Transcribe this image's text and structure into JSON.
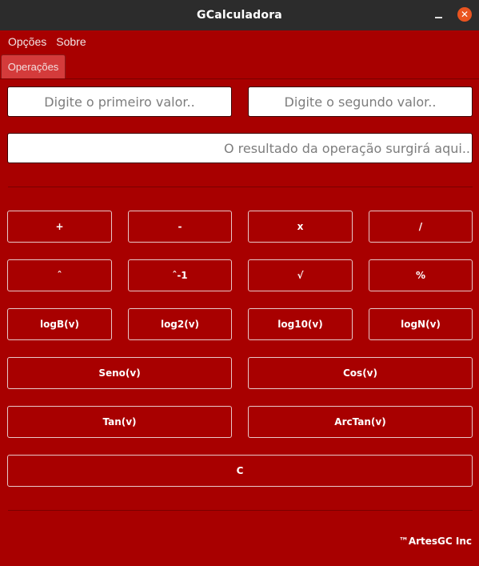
{
  "window": {
    "title": "GCalculadora",
    "minimize_icon": "minimize-icon",
    "close_icon": "close-icon",
    "close_glyph": "✕",
    "close_color": "#e95420"
  },
  "menu": {
    "items": [
      "Opções",
      "Sobre"
    ]
  },
  "tabs": [
    {
      "label": "Operações",
      "active": true
    }
  ],
  "inputs": {
    "first_placeholder": "Digite o primeiro valor..",
    "second_placeholder": "Digite o segundo valor..",
    "result_placeholder": "O resultado da operação surgirá aqui.."
  },
  "buttons": {
    "row1": [
      "+",
      "-",
      "x",
      "/"
    ],
    "row2": [
      "ˆ",
      "ˆ-1",
      "√",
      "%"
    ],
    "row3": [
      "logB(v)",
      "log2(v)",
      "log10(v)",
      "logN(v)"
    ],
    "row4": [
      "Seno(v)",
      "Cos(v)"
    ],
    "row5": [
      "Tan(v)",
      "ArcTan(v)"
    ],
    "row6": [
      "C"
    ]
  },
  "footer": {
    "text": "™ArtesGC Inc"
  },
  "colors": {
    "background": "#a80000",
    "titlebar": "#2c2c2c",
    "tab_active": "#d43b3b"
  }
}
